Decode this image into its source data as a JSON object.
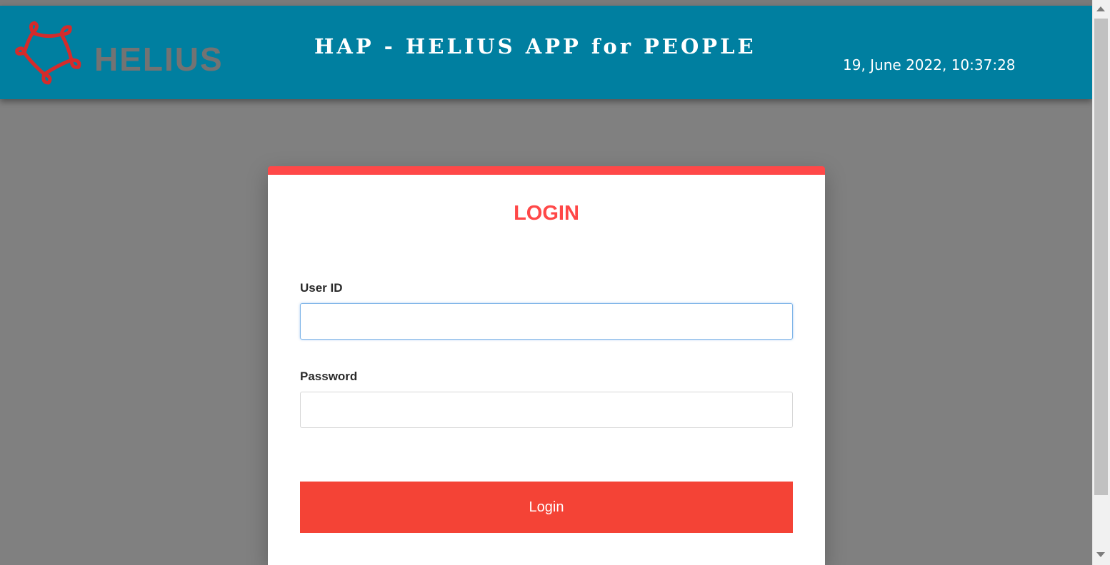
{
  "header": {
    "logo_text": "HELIUS",
    "app_title": "HAP - HELIUS APP for PEOPLE",
    "datetime": "19, June 2022, 10:37:28"
  },
  "login_form": {
    "title": "LOGIN",
    "user_id": {
      "label": "User ID",
      "value": "",
      "placeholder": ""
    },
    "password": {
      "label": "Password",
      "value": "",
      "placeholder": ""
    },
    "submit_label": "Login"
  },
  "colors": {
    "header_bg": "#007fa0",
    "accent": "#ff4848",
    "button": "#f44336",
    "overlay_bg": "#808080"
  },
  "icons": {
    "logo": "helius-knot-logo-icon",
    "scroll_up": "scroll-up-arrow-icon",
    "scroll_down": "scroll-down-arrow-icon"
  }
}
